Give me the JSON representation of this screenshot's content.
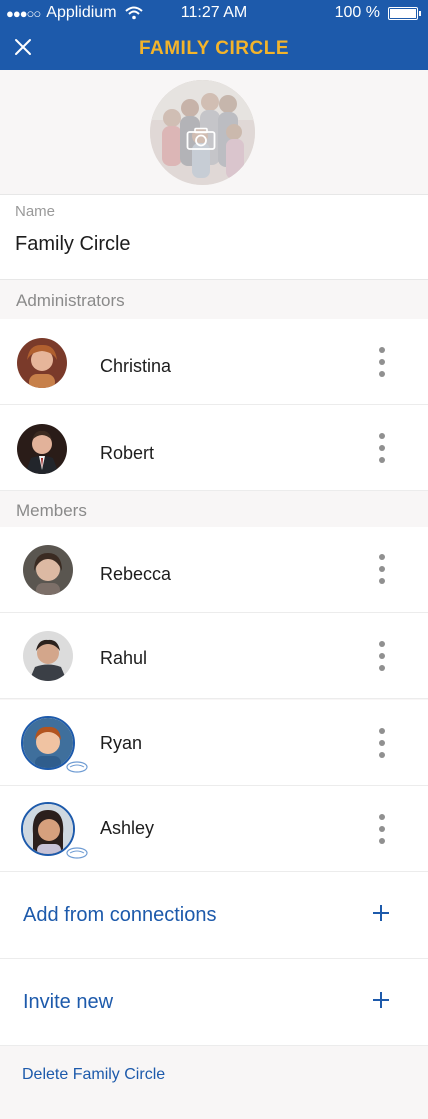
{
  "status_bar": {
    "signal_dots": "●●●○○",
    "carrier": "Applidium",
    "time": "11:27 AM",
    "battery_percent": "100 %",
    "icons": [
      "wifi-icon",
      "battery-icon"
    ]
  },
  "header": {
    "title": "FAMILY CIRCLE",
    "close_icon": "close-icon",
    "background": "#1d5aab",
    "title_color": "#f3b42b"
  },
  "group_photo": {
    "icon": "camera-icon"
  },
  "name_field": {
    "label": "Name",
    "value": "Family Circle"
  },
  "administrators": {
    "heading": "Administrators",
    "people": [
      {
        "name": "Christina",
        "menu_icon": "more-vertical-icon"
      },
      {
        "name": "Robert",
        "menu_icon": "more-vertical-icon"
      }
    ]
  },
  "members": {
    "heading": "Members",
    "people": [
      {
        "name": "Rebecca",
        "menu_icon": "more-vertical-icon"
      },
      {
        "name": "Rahul",
        "menu_icon": "more-vertical-icon"
      },
      {
        "name": "Ryan",
        "menu_icon": "more-vertical-icon",
        "badge_icon": "child-account-icon"
      },
      {
        "name": "Ashley",
        "menu_icon": "more-vertical-icon",
        "badge_icon": "child-account-icon"
      }
    ]
  },
  "actions": {
    "add_from_connections": "Add from connections",
    "invite_new": "Invite new",
    "plus_icon": "plus-icon"
  },
  "delete_link": "Delete Family Circle",
  "colors": {
    "accent": "#1d5aab",
    "title_yellow": "#f3b42b",
    "background": "#f8f6f6",
    "muted_text": "#8a8a8a"
  }
}
